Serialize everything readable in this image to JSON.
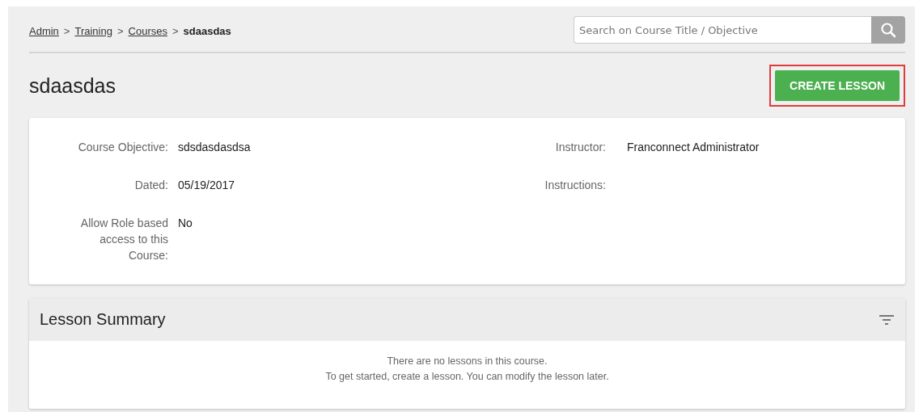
{
  "breadcrumb": [
    {
      "label": "Admin",
      "kind": "link"
    },
    {
      "label": ">",
      "kind": "separator"
    },
    {
      "label": "Training",
      "kind": "link"
    },
    {
      "label": ">",
      "kind": "separator"
    },
    {
      "label": "Courses",
      "kind": "link"
    },
    {
      "label": ">",
      "kind": "separator"
    },
    {
      "label": "sdaasdas",
      "kind": "current"
    }
  ],
  "search": {
    "placeholder": "Search on Course Title / Objective"
  },
  "title": "sdaasdas",
  "create_button": {
    "label": "CREATE LESSON",
    "highlighted": true
  },
  "details": {
    "left": [
      {
        "label": "Course Objective:",
        "value": "sdsdasdasdsa"
      },
      {
        "label": "Dated:",
        "value": "05/19/2017"
      },
      {
        "label": "Allow Role based access to this Course:",
        "value": "No"
      }
    ],
    "right": [
      {
        "label": "Instructor:",
        "value": "Franconnect Administrator"
      },
      {
        "label": "Instructions:"
      }
    ]
  },
  "lesson_summary": {
    "title": "Lesson Summary",
    "empty_lines": [
      "There are no lessons in this course.",
      "To get started, create a lesson. You can modify the lesson later."
    ]
  }
}
